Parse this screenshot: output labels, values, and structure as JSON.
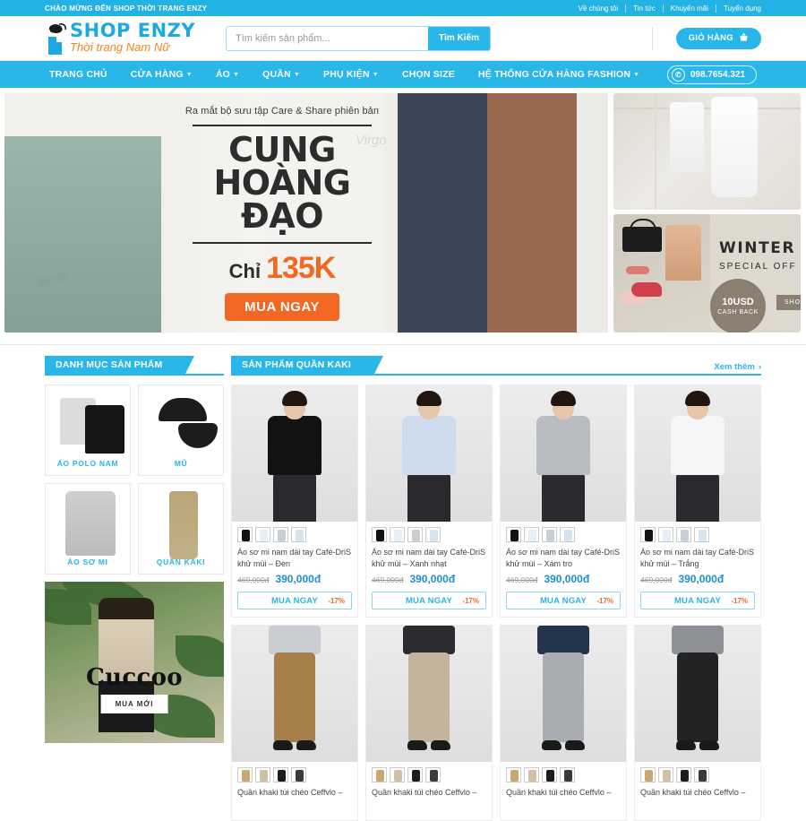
{
  "topbar": {
    "welcome": "CHÀO MỪNG ĐẾN SHOP THỜI TRANG ENZY",
    "links": [
      {
        "label": "Về chúng tôi"
      },
      {
        "label": "Tin tức"
      },
      {
        "label": "Khuyến mãi"
      },
      {
        "label": "Tuyển dụng"
      }
    ]
  },
  "header": {
    "logo_main": "SHOP ENZY",
    "logo_sub": "Thời trang Nam Nữ",
    "search_placeholder": "Tìm kiếm sản phẩm...",
    "search_value": "",
    "search_button": "Tìm Kiếm",
    "cart_label": "GIỎ HÀNG",
    "cart_icon": "basket-icon"
  },
  "nav": {
    "items": [
      {
        "label": "TRANG CHỦ",
        "dropdown": false
      },
      {
        "label": "CỬA HÀNG",
        "dropdown": true
      },
      {
        "label": "ÁO",
        "dropdown": true
      },
      {
        "label": "QUẦN",
        "dropdown": true
      },
      {
        "label": "PHỤ KIỆN",
        "dropdown": true
      },
      {
        "label": "CHỌN SIZE",
        "dropdown": false
      },
      {
        "label": "HỆ THỐNG CỬA HÀNG FASHION",
        "dropdown": true
      }
    ],
    "phone": "098.7654.321",
    "phone_icon": "phone-icon"
  },
  "hero": {
    "kicker": "Ra mắt bộ sưu tập Care & Share phiên bản",
    "title_line1": "CUNG",
    "title_line2": "HOÀNG",
    "title_line3": "ĐẠO",
    "price_prefix": "Chỉ",
    "price_amount": "135K",
    "cta": "MUA NGAY",
    "zodiac_labels": [
      "Virgo",
      "Pises"
    ]
  },
  "winter_banner": {
    "title": "WINTER SALE",
    "subtitle": "SPECIAL OFF",
    "badge_amount": "10USD",
    "badge_text": "CASH BACK",
    "shop_button": "SHOP NOW"
  },
  "sidebar": {
    "section_title": "DANH MỤC SẢN PHẨM",
    "categories": [
      {
        "label": "ÁO POLO NAM",
        "art": "polo"
      },
      {
        "label": "MŨ",
        "art": "cap"
      },
      {
        "label": "ÁO SƠ MI",
        "art": "shirt"
      },
      {
        "label": "QUẦN KAKI",
        "art": "pant"
      }
    ],
    "promo": {
      "title": "Cuccoo",
      "button": "MUA MỚI"
    }
  },
  "products_section": {
    "title": "SẢN PHẨM QUẦN KAKI",
    "more_label": "Xem thêm",
    "more_icon": "chevron-right-icon",
    "buy_label": "MUA NGAY",
    "row1": [
      {
        "name": "Áo sơ mi nam dài tay Café-DriS khử mùi – Đen",
        "price_old": "469,000đ",
        "price_new": "390,000đ",
        "discount": "-17%",
        "shirt_color": "#121212",
        "swatches": [
          "#121212",
          "#e8eef5",
          "#c9ced4",
          "#d6e3f0"
        ]
      },
      {
        "name": "Áo sơ mi nam dài tay Café-DriS khử mùi – Xanh nhạt",
        "price_old": "469,000đ",
        "price_new": "390,000đ",
        "discount": "-17%",
        "shirt_color": "#cfdced",
        "swatches": [
          "#121212",
          "#e8eef5",
          "#c9ced4",
          "#d6e3f0"
        ]
      },
      {
        "name": "Áo sơ mi nam dài tay Café-DriS khử mùi – Xám tro",
        "price_old": "469,000đ",
        "price_new": "390,000đ",
        "discount": "-17%",
        "shirt_color": "#b9bcc0",
        "swatches": [
          "#121212",
          "#e8eef5",
          "#c9ced4",
          "#d6e3f0"
        ]
      },
      {
        "name": "Áo sơ mi nam dài tay Café-DriS khử mùi – Trắng",
        "price_old": "469,000đ",
        "price_new": "390,000đ",
        "discount": "-17%",
        "shirt_color": "#f4f6f8",
        "swatches": [
          "#121212",
          "#e8eef5",
          "#c9ced4",
          "#d6e3f0"
        ]
      }
    ],
    "row2": [
      {
        "name": "Quần khaki túi chéo Ceffvlo –",
        "pant_color": "#a57f47",
        "top_color": "#c9ccd1",
        "swatches": [
          "#c8a871",
          "#cfc1a3",
          "#1c1c1c",
          "#3a3a3a"
        ]
      },
      {
        "name": "Quần khaki túi chéo Ceffvlo –",
        "pant_color": "#c2b49d",
        "top_color": "#2c2c30",
        "swatches": [
          "#c8a871",
          "#cfc1a3",
          "#1c1c1c",
          "#3a3a3a"
        ]
      },
      {
        "name": "Quần khaki túi chéo Ceffvlo –",
        "pant_color": "#a9adb2",
        "top_color": "#24344c",
        "swatches": [
          "#c8a871",
          "#cfc1a3",
          "#1c1c1c",
          "#3a3a3a"
        ]
      },
      {
        "name": "Quần khaki túi chéo Ceffvlo –",
        "pant_color": "#232326",
        "top_color": "#8d9095",
        "swatches": [
          "#c8a871",
          "#cfc1a3",
          "#1c1c1c",
          "#3a3a3a"
        ]
      }
    ]
  },
  "colors": {
    "brand_blue": "#29b6e8",
    "accent_orange": "#f26722",
    "price_blue": "#1f8ecf",
    "logo_orange": "#f1861f"
  }
}
